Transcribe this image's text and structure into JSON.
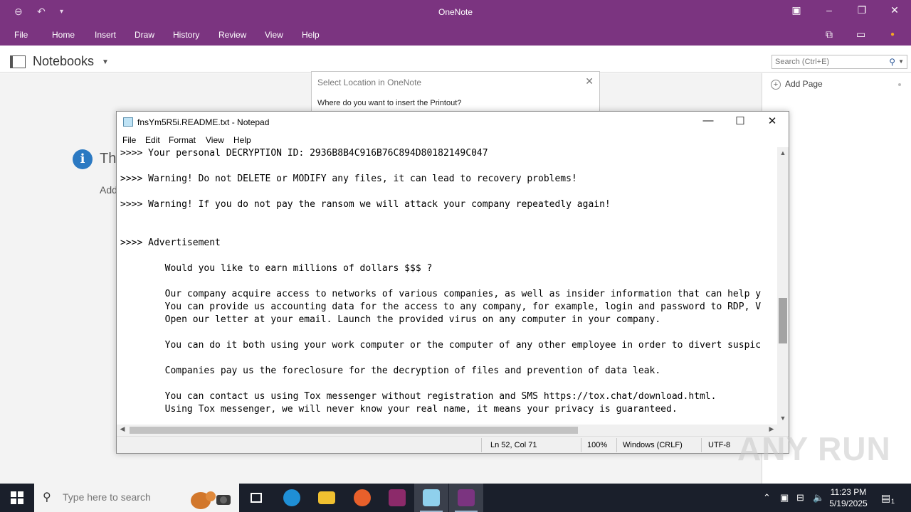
{
  "onenote": {
    "title": "OneNote",
    "ribbon_tabs": [
      "File",
      "Home",
      "Insert",
      "Draw",
      "History",
      "Review",
      "View",
      "Help"
    ],
    "notebooks_label": "Notebooks",
    "search_placeholder": "Search (Ctrl+E)",
    "add_page_label": "Add Page",
    "behind_heading": "Th",
    "behind_sub": "Add"
  },
  "select_location": {
    "title": "Select Location in OneNote",
    "question": "Where do you want to insert the Printout?"
  },
  "notepad": {
    "title": "fnsYm5R5i.README.txt - Notepad",
    "menu": [
      "File",
      "Edit",
      "Format",
      "View",
      "Help"
    ],
    "lines": [
      ">>>> Your personal DECRYPTION ID: 2936B8B4C916B76C894D80182149C047",
      "",
      ">>>> Warning! Do not DELETE or MODIFY any files, it can lead to recovery problems!",
      "",
      ">>>> Warning! If you do not pay the ransom we will attack your company repeatedly again!",
      "",
      "",
      ">>>> Advertisement",
      "",
      "        Would you like to earn millions of dollars $$$ ?",
      "",
      "        Our company acquire access to networks of various companies, as well as insider information that can help y",
      "        You can provide us accounting data for the access to any company, for example, login and password to RDP, V",
      "        Open our letter at your email. Launch the provided virus on any computer in your company.",
      "",
      "        You can do it both using your work computer or the computer of any other employee in order to divert suspic",
      "",
      "        Companies pay us the foreclosure for the decryption of files and prevention of data leak.",
      "",
      "        You can contact us using Tox messenger without registration and SMS https://tox.chat/download.html.",
      "        Using Tox messenger, we will never know your real name, it means your privacy is guaranteed."
    ],
    "status": {
      "position": "Ln 52, Col 71",
      "zoom": "100%",
      "line_ending": "Windows (CRLF)",
      "encoding": "UTF-8"
    }
  },
  "watermark": "ANY RUN",
  "taskbar": {
    "search_placeholder": "Type here to search",
    "time": "11:23 PM",
    "date": "5/19/2025",
    "notification_count": "1"
  }
}
